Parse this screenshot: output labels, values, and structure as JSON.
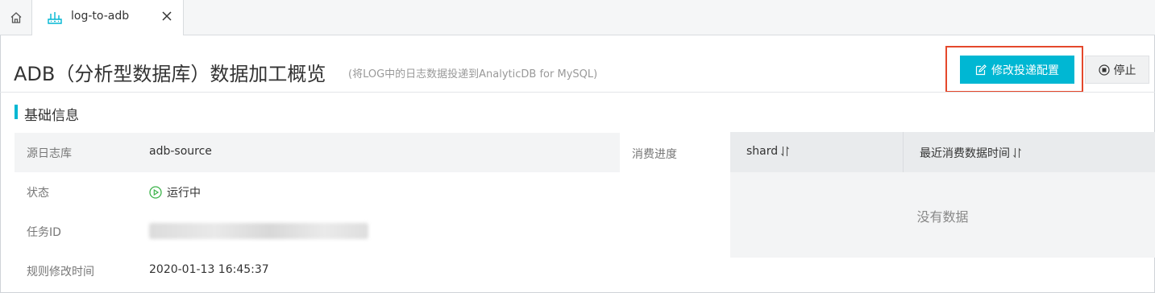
{
  "tab": {
    "label": "log-to-adb"
  },
  "header": {
    "title": "ADB（分析型数据库）数据加工概览",
    "subtitle": "(将LOG中的日志数据投递到AnalyticDB for MySQL)",
    "edit_button": "修改投递配置",
    "stop_button": "停止"
  },
  "section": {
    "title": "基础信息"
  },
  "info": {
    "source_label": "源日志库",
    "source_value": "adb-source",
    "status_label": "状态",
    "status_value": "运行中",
    "task_id_label": "任务ID",
    "modified_label": "规则修改时间",
    "modified_value": "2020-01-13 16:45:37"
  },
  "progress": {
    "label": "消费进度",
    "columns": [
      "shard",
      "最近消费数据时间"
    ],
    "empty_text": "没有数据"
  },
  "colors": {
    "accent": "#00b7d3",
    "highlight_border": "#e4482c",
    "status_green": "#3cb34a"
  }
}
